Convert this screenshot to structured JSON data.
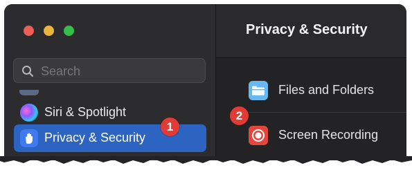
{
  "sidebar": {
    "search": {
      "placeholder": "Search"
    },
    "items": [
      {
        "label": "Siri & Spotlight",
        "icon": "siri-icon"
      },
      {
        "label": "Privacy & Security",
        "icon": "hand-icon",
        "selected": true
      }
    ]
  },
  "header": {
    "title": "Privacy & Security"
  },
  "main": {
    "rows": [
      {
        "label": "Files and Folders",
        "icon": "folder-icon"
      },
      {
        "label": "Screen Recording",
        "icon": "screen-recording-icon"
      }
    ]
  },
  "annotations": {
    "badge_1": "1",
    "badge_2": "2"
  },
  "colors": {
    "selection": "#2d63c1",
    "badge": "#e13b35",
    "window_background": "#232326"
  }
}
